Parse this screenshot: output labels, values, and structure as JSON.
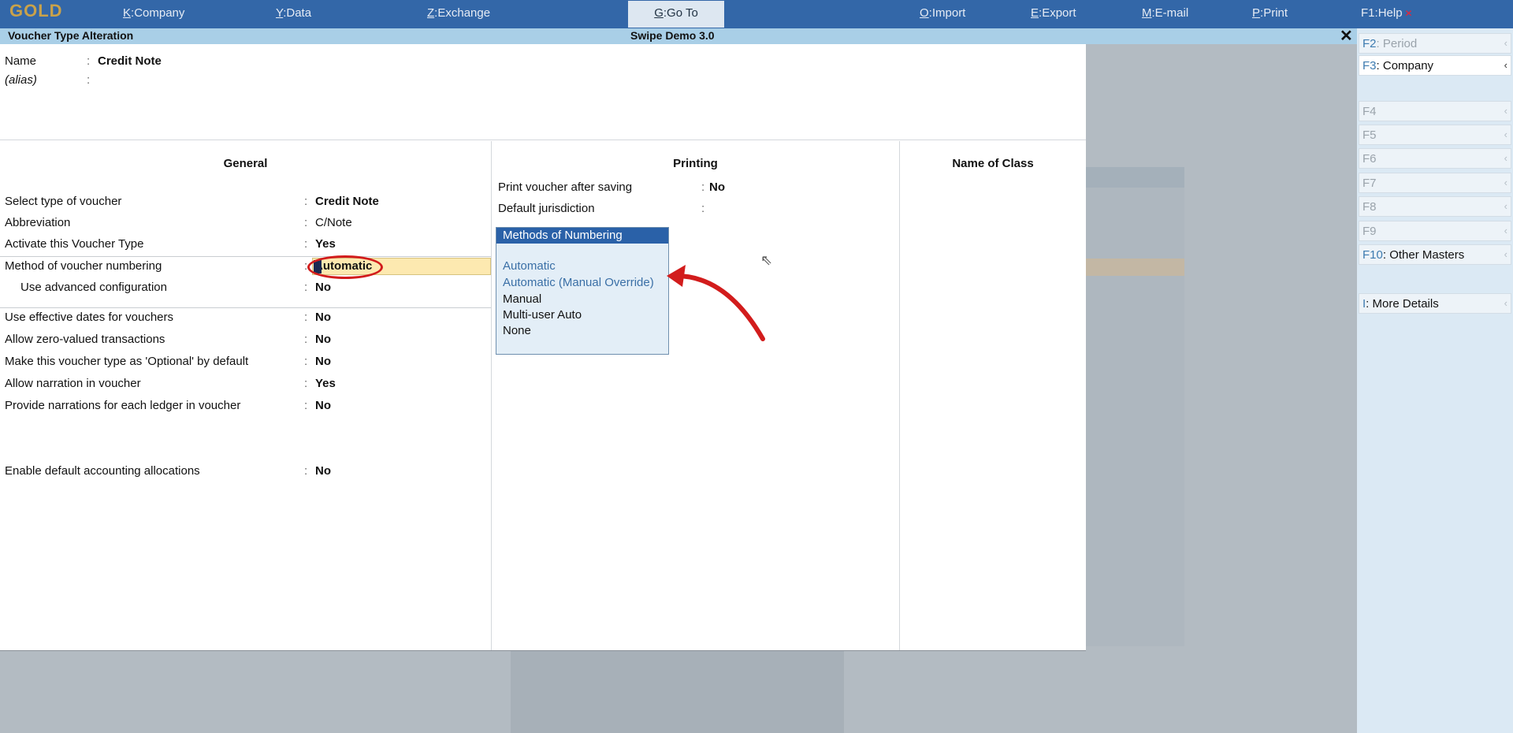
{
  "app": {
    "logo": "GOLD",
    "menu": [
      {
        "key": "K",
        "label": "Company"
      },
      {
        "key": "Y",
        "label": "Data"
      },
      {
        "key": "Z",
        "label": "Exchange"
      },
      {
        "key": "G",
        "label": "Go To"
      },
      {
        "key": "O",
        "label": "Import"
      },
      {
        "key": "E",
        "label": "Export"
      },
      {
        "key": "M",
        "label": "E-mail"
      },
      {
        "key": "P",
        "label": "Print"
      },
      {
        "key": "F1",
        "label": "Help"
      }
    ]
  },
  "window": {
    "title": "Voucher Type Alteration",
    "company": "Swipe Demo 3.0",
    "close_glyph": "✕"
  },
  "header": {
    "name_label": "Name",
    "name_value": "Credit Note",
    "alias_label": "(alias)",
    "colon": ":"
  },
  "columns": {
    "general": "General",
    "printing": "Printing",
    "name_of_class": "Name of Class"
  },
  "general": {
    "rows": [
      {
        "label": "Select type of voucher",
        "value": "Credit Note"
      },
      {
        "label": "Abbreviation",
        "value": "C/Note"
      },
      {
        "label": "Activate this Voucher Type",
        "value": "Yes"
      },
      {
        "label": "Method of voucher numbering",
        "value": "Automatic"
      },
      {
        "label": "Use advanced configuration",
        "value": "No"
      },
      {
        "label": "Use effective dates for vouchers",
        "value": "No"
      },
      {
        "label": "Allow zero-valued transactions",
        "value": "No"
      },
      {
        "label": "Make this voucher type as 'Optional' by default",
        "value": "No"
      },
      {
        "label": "Allow narration in voucher",
        "value": "Yes"
      },
      {
        "label": "Provide narrations for each ledger in voucher",
        "value": "No"
      },
      {
        "label": "Enable default accounting allocations",
        "value": "No"
      }
    ]
  },
  "printing": {
    "print_after_saving_label": "Print voucher after saving",
    "print_after_saving_value": "No",
    "default_jurisdiction_label": "Default jurisdiction"
  },
  "popup": {
    "title": "Methods of Numbering",
    "items": [
      "Automatic",
      "Automatic (Manual Override)",
      "Manual",
      "Multi-user Auto",
      "None"
    ]
  },
  "sidebar": {
    "buttons": [
      {
        "key": "F2",
        "label": "Period"
      },
      {
        "key": "F3",
        "label": "Company"
      },
      {
        "key": "F4",
        "label": ""
      },
      {
        "key": "F5",
        "label": ""
      },
      {
        "key": "F6",
        "label": ""
      },
      {
        "key": "F7",
        "label": ""
      },
      {
        "key": "F8",
        "label": ""
      },
      {
        "key": "F9",
        "label": ""
      },
      {
        "key": "F10",
        "label": "Other Masters"
      },
      {
        "key": "I",
        "label": "More Details"
      }
    ]
  },
  "colors": {
    "topbar": "#3367a8",
    "titlebar": "#a9cfe7",
    "active_field": "#fde9b0",
    "annotation_red": "#d21c1c"
  }
}
